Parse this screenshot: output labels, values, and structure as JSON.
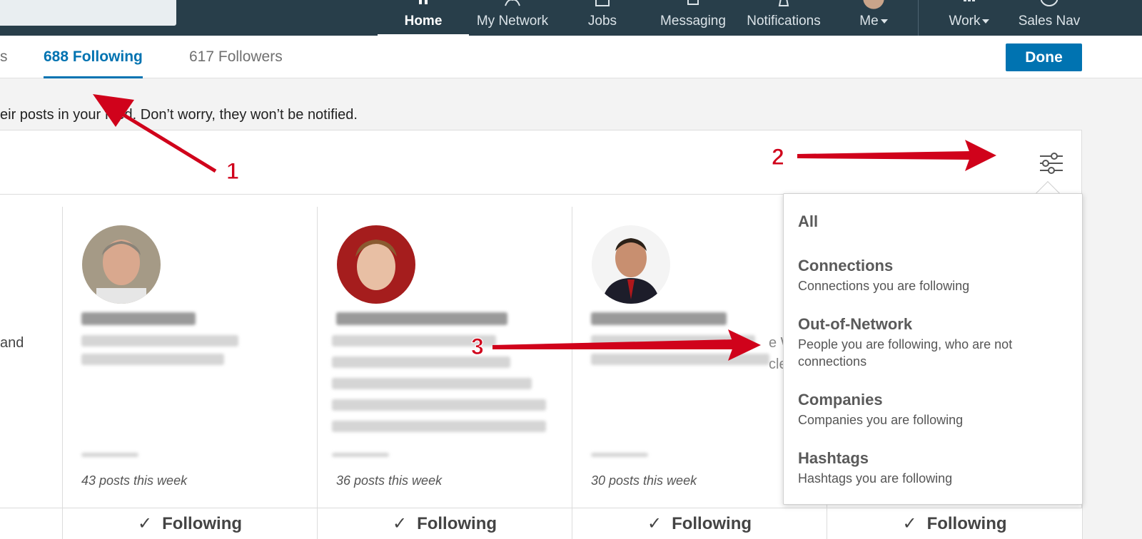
{
  "nav": {
    "items": [
      {
        "label": "Home",
        "icon": "home-icon",
        "active": true
      },
      {
        "label": "My Network",
        "icon": "network-icon"
      },
      {
        "label": "Jobs",
        "icon": "jobs-icon"
      },
      {
        "label": "Messaging",
        "icon": "messaging-icon"
      },
      {
        "label": "Notifications",
        "icon": "bell-icon"
      },
      {
        "label": "Me",
        "icon": "avatar"
      },
      {
        "label": "Work",
        "icon": "grid-icon"
      },
      {
        "label": "Sales Nav",
        "icon": "compass-icon"
      }
    ]
  },
  "tabs": {
    "partial": "s",
    "following": "688 Following",
    "followers": "617 Followers"
  },
  "done_label": "Done",
  "info_text": "eir posts in your feed. Don’t worry, they won’t be notified.",
  "partial_card_text": "and",
  "partial_card_text_right": "e W",
  "partial_card_text_right2": "cle",
  "cards": [
    {
      "posts": "43 posts this week",
      "action": "Following"
    },
    {
      "posts": "36 posts this week",
      "action": "Following"
    },
    {
      "posts": "30 posts this week",
      "action": "Following"
    },
    {
      "posts": "",
      "action": "Following"
    }
  ],
  "filter_menu": {
    "items": [
      {
        "title": "All",
        "desc": ""
      },
      {
        "title": "Connections",
        "desc": "Connections you are following"
      },
      {
        "title": "Out-of-Network",
        "desc": "People you are following, who are not connections"
      },
      {
        "title": "Companies",
        "desc": "Companies you are following"
      },
      {
        "title": "Hashtags",
        "desc": "Hashtags you are following"
      }
    ]
  },
  "annotations": {
    "one": "1",
    "two": "2",
    "three": "3"
  },
  "colors": {
    "nav_bg": "#283e4a",
    "accent": "#0073b1",
    "annotation": "#d0021b"
  }
}
